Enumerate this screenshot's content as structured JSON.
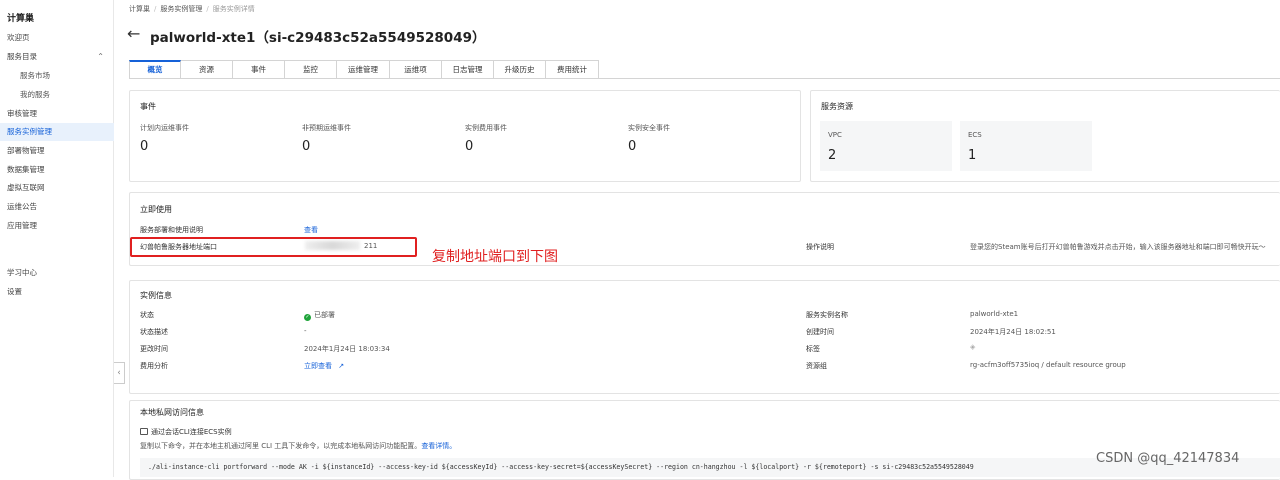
{
  "sidebar": {
    "title": "计算巢",
    "items": [
      {
        "label": "欢迎页"
      },
      {
        "label": "服务目录"
      },
      {
        "label": "服务市场"
      },
      {
        "label": "我的服务"
      },
      {
        "label": "审核管理"
      },
      {
        "label": "服务实例管理"
      },
      {
        "label": "部署物管理"
      },
      {
        "label": "数据集管理"
      },
      {
        "label": "虚拟互联网"
      },
      {
        "label": "运维公告"
      },
      {
        "label": "应用管理"
      },
      {
        "label": "学习中心"
      },
      {
        "label": "设置"
      }
    ],
    "collapse_glyph": "‹"
  },
  "breadcrumb": {
    "items": [
      "计算巢",
      "服务实例管理",
      "服务实例详情"
    ]
  },
  "page": {
    "title": "palworld-xte1（si-c29483c52a5549528049）"
  },
  "tabs": [
    "概览",
    "资源",
    "事件",
    "监控",
    "运维管理",
    "运维项",
    "日志管理",
    "升级历史",
    "费用统计"
  ],
  "events": {
    "title": "事件",
    "items": [
      {
        "label": "计划内运维事件",
        "value": "0"
      },
      {
        "label": "非预期运维事件",
        "value": "0"
      },
      {
        "label": "实例费用事件",
        "value": "0"
      },
      {
        "label": "实例安全事件",
        "value": "0"
      }
    ]
  },
  "resources": {
    "title": "服务资源",
    "items": [
      {
        "label": "VPC",
        "value": "2"
      },
      {
        "label": "ECS",
        "value": "1"
      }
    ]
  },
  "quickuse": {
    "title": "立即使用",
    "doc_label": "服务部署和使用说明",
    "doc_link": "查看",
    "addr_label": "幻兽帕鲁服务器地址端口",
    "addr_value_suffix": "211",
    "op_label": "操作说明",
    "op_value": "登录您的Steam账号后打开幻兽帕鲁游戏并点击开始，输入该服务器地址和端口即可畅快开玩～"
  },
  "annotation": "复制地址端口到下图",
  "instance": {
    "title": "实例信息",
    "status_label": "状态",
    "status_value": "已部署",
    "status_desc_label": "状态描述",
    "status_desc_value": "-",
    "modified_label": "更改时间",
    "modified_value": "2024年1月24日 18:03:34",
    "cost_label": "费用分析",
    "cost_link": "立即查看",
    "name_label": "服务实例名称",
    "name_value": "palworld-xte1",
    "created_label": "创建时间",
    "created_value": "2024年1月24日 18:02:51",
    "tag_label": "标签",
    "rg_label": "资源组",
    "rg_value": "rg-acfm3off5735ioq / default resource group"
  },
  "private": {
    "title": "本地私网访问信息",
    "cli_label": "通过会话CLI连接ECS实例",
    "desc": "复制以下命令，并在本地主机通过阿里 CLI 工具下发命令，以完成本地私网访问功能配置。",
    "desc_link": "查看详情。",
    "command": "./ali-instance-cli portforward --mode AK -i ${instanceId} --access-key-id ${accessKeyId} --access-key-secret=${accessKeySecret} --region cn-hangzhou -l ${localport} -r ${remoteport} -s si-c29483c52a5549528049"
  },
  "watermark": "CSDN @qq_42147834",
  "colors": {
    "accent": "#1561d8",
    "annotation": "#e02020",
    "status_ok": "#1fa43a"
  }
}
